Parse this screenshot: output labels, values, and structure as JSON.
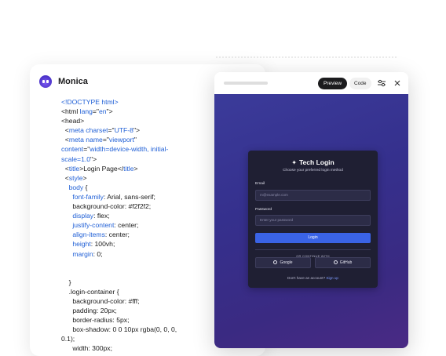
{
  "app": {
    "name": "Monica"
  },
  "code_lines": [
    {
      "indent": 0,
      "parts": [
        {
          "t": "<!DOCTYPE html>",
          "c": "blue"
        }
      ]
    },
    {
      "indent": 0,
      "parts": [
        {
          "t": "<html ",
          "c": "tag"
        },
        {
          "t": "lang",
          "c": "blue"
        },
        {
          "t": "=\"",
          "c": "tag"
        },
        {
          "t": "en",
          "c": "blue"
        },
        {
          "t": "\">",
          "c": "tag"
        }
      ]
    },
    {
      "indent": 0,
      "parts": [
        {
          "t": "<head>",
          "c": "tag"
        }
      ]
    },
    {
      "indent": 1,
      "parts": [
        {
          "t": "<",
          "c": "tag"
        },
        {
          "t": "meta charset",
          "c": "blue"
        },
        {
          "t": "=\"",
          "c": "tag"
        },
        {
          "t": "UTF-8",
          "c": "blue"
        },
        {
          "t": "\">",
          "c": "tag"
        }
      ]
    },
    {
      "indent": 1,
      "parts": [
        {
          "t": "<",
          "c": "tag"
        },
        {
          "t": "meta name",
          "c": "blue"
        },
        {
          "t": "=\"",
          "c": "tag"
        },
        {
          "t": "viewport",
          "c": "blue"
        },
        {
          "t": "\"",
          "c": "tag"
        }
      ]
    },
    {
      "indent": 0,
      "parts": [
        {
          "t": "content",
          "c": "blue"
        },
        {
          "t": "=\"",
          "c": "tag"
        },
        {
          "t": "width=device-width, initial-",
          "c": "blue"
        }
      ]
    },
    {
      "indent": 0,
      "parts": [
        {
          "t": "scale=1.0",
          "c": "blue"
        },
        {
          "t": "\">",
          "c": "tag"
        }
      ]
    },
    {
      "indent": 1,
      "parts": [
        {
          "t": "<",
          "c": "tag"
        },
        {
          "t": "title",
          "c": "blue"
        },
        {
          "t": ">Login Page</",
          "c": "tag"
        },
        {
          "t": "title",
          "c": "blue"
        },
        {
          "t": ">",
          "c": "tag"
        }
      ]
    },
    {
      "indent": 1,
      "parts": [
        {
          "t": "<",
          "c": "tag"
        },
        {
          "t": "style",
          "c": "blue"
        },
        {
          "t": ">",
          "c": "tag"
        }
      ]
    },
    {
      "indent": 2,
      "parts": [
        {
          "t": "body",
          "c": "blue"
        },
        {
          "t": " {",
          "c": "tag"
        }
      ]
    },
    {
      "indent": 3,
      "parts": [
        {
          "t": "font-family",
          "c": "blue"
        },
        {
          "t": ": Arial, sans-serif;",
          "c": "tag"
        }
      ]
    },
    {
      "indent": 3,
      "parts": [
        {
          "t": "background-color: #f2f2f2;",
          "c": "tag"
        }
      ]
    },
    {
      "indent": 3,
      "parts": [
        {
          "t": "display",
          "c": "blue"
        },
        {
          "t": ": flex;",
          "c": "tag"
        }
      ]
    },
    {
      "indent": 3,
      "parts": [
        {
          "t": "justify-content",
          "c": "blue"
        },
        {
          "t": ": center;",
          "c": "tag"
        }
      ]
    },
    {
      "indent": 3,
      "parts": [
        {
          "t": "align-items",
          "c": "blue"
        },
        {
          "t": ": center;",
          "c": "tag"
        }
      ]
    },
    {
      "indent": 3,
      "parts": [
        {
          "t": "height",
          "c": "blue"
        },
        {
          "t": ": 100vh;",
          "c": "tag"
        }
      ]
    },
    {
      "indent": 3,
      "parts": [
        {
          "t": "margin",
          "c": "blue"
        },
        {
          "t": ": 0;",
          "c": "tag"
        }
      ]
    },
    {
      "indent": 0,
      "parts": []
    },
    {
      "indent": 0,
      "parts": []
    },
    {
      "indent": 2,
      "parts": [
        {
          "t": "}",
          "c": "tag"
        }
      ]
    },
    {
      "indent": 2,
      "parts": [
        {
          "t": ".login-container {",
          "c": "tag"
        }
      ]
    },
    {
      "indent": 3,
      "parts": [
        {
          "t": "background-color: #fff;",
          "c": "tag"
        }
      ]
    },
    {
      "indent": 3,
      "parts": [
        {
          "t": "padding: 20px;",
          "c": "tag"
        }
      ]
    },
    {
      "indent": 3,
      "parts": [
        {
          "t": "border-radius: 5px;",
          "c": "tag"
        }
      ]
    },
    {
      "indent": 3,
      "parts": [
        {
          "t": "box-shadow: 0 0 10px rgba(0, 0, 0,",
          "c": "tag"
        }
      ]
    },
    {
      "indent": 0,
      "parts": [
        {
          "t": "0.1);",
          "c": "tag"
        }
      ]
    },
    {
      "indent": 3,
      "parts": [
        {
          "t": "width: 300px;",
          "c": "tag"
        }
      ]
    }
  ],
  "preview": {
    "tabs": {
      "preview": "Preview",
      "code": "Code"
    },
    "login": {
      "title": "Tech Login",
      "subtitle": "Choose your preferred login method",
      "email_label": "Email",
      "email_placeholder": "m@example.com",
      "password_label": "Password",
      "password_placeholder": "Enter your password",
      "login_button": "Login",
      "divider_text": "OR CONTINUE WITH",
      "google_button": "Google",
      "github_button": "GitHub",
      "footer_text": "Don't have an account?",
      "signup_link": "Sign up"
    }
  },
  "colors": {
    "accent": "#3a63e6",
    "code_blue": "#1f5fd6",
    "card_bg": "#1f1f33",
    "canvas_top": "#3b3b9a",
    "canvas_bottom": "#4a2a84"
  }
}
